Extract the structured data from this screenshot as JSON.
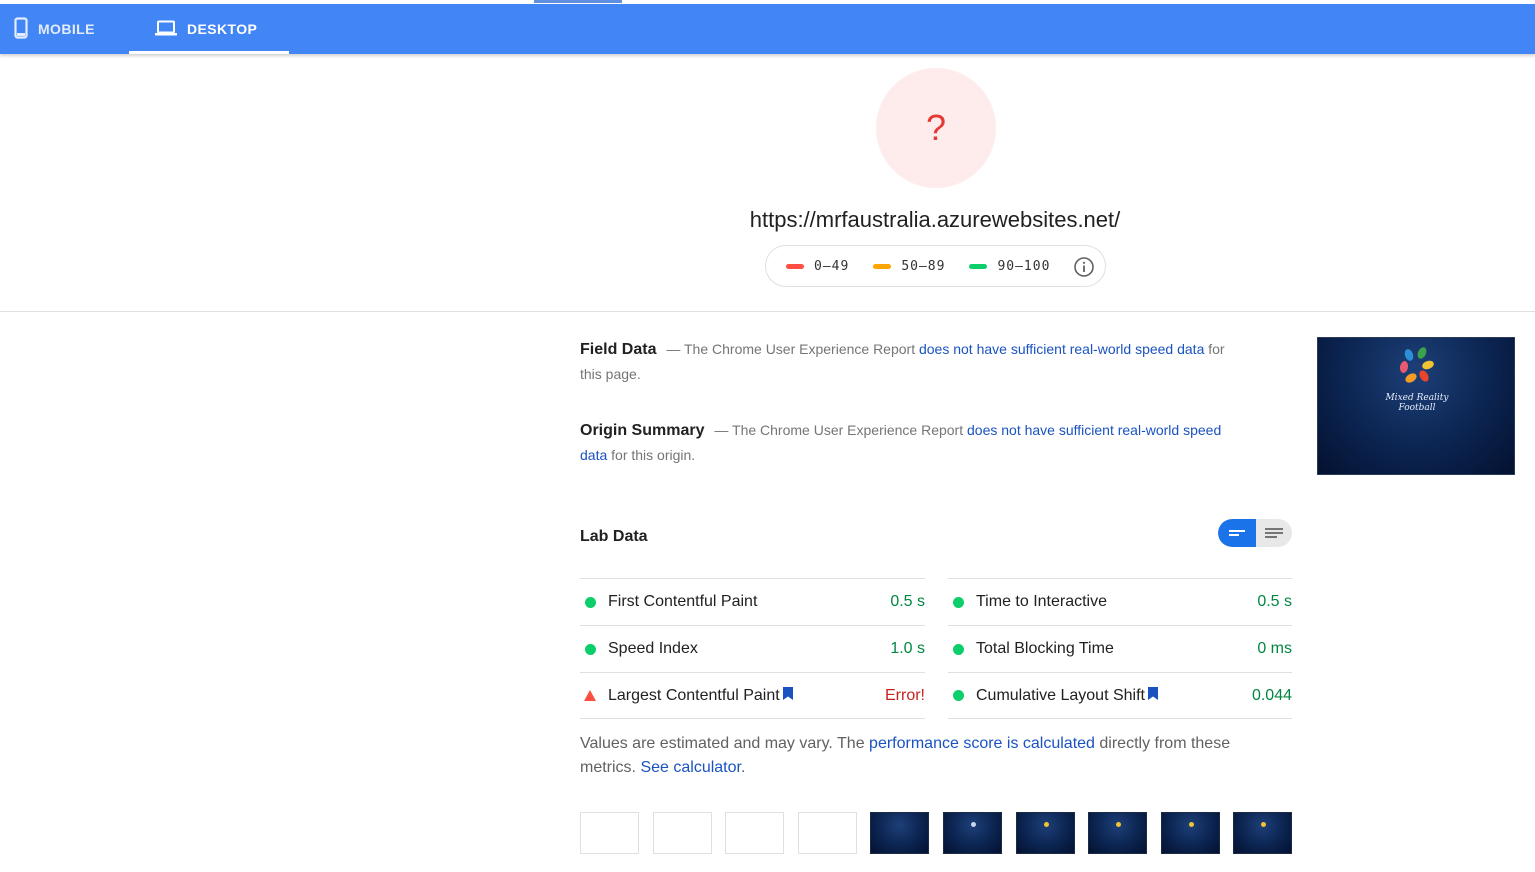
{
  "tabs": [
    {
      "label": "MOBILE",
      "icon": "phone-icon"
    },
    {
      "label": "DESKTOP",
      "icon": "laptop-icon",
      "selected": true
    }
  ],
  "score": {
    "value": "?",
    "color": "#e53935"
  },
  "url": "https://mrfaustralia.azurewebsites.net/",
  "legend": [
    {
      "label": "0–49",
      "color": "#ff4e42"
    },
    {
      "label": "50–89",
      "color": "#ffa400"
    },
    {
      "label": "90–100",
      "color": "#0cce6b"
    }
  ],
  "field_data": {
    "title": "Field Data",
    "prefix": "— The Chrome User Experience Report",
    "link": "does not have sufficient real-world speed data",
    "suffix": "for this page."
  },
  "origin_summary": {
    "title": "Origin Summary",
    "prefix": "— The Chrome User Experience Report",
    "link": "does not have sufficient real-world speed data",
    "suffix": "for this origin."
  },
  "screenshot": {
    "text_line1": "Mixed Reality",
    "text_line2": "Football"
  },
  "lab_data": {
    "title": "Lab Data",
    "metrics_left": [
      {
        "name": "First Contentful Paint",
        "value": "0.5 s",
        "status": "pass"
      },
      {
        "name": "Speed Index",
        "value": "1.0 s",
        "status": "pass"
      },
      {
        "name": "Largest Contentful Paint",
        "value": "Error!",
        "status": "fail",
        "bookmark": true
      }
    ],
    "metrics_right": [
      {
        "name": "Time to Interactive",
        "value": "0.5 s",
        "status": "pass"
      },
      {
        "name": "Total Blocking Time",
        "value": "0 ms",
        "status": "pass"
      },
      {
        "name": "Cumulative Layout Shift",
        "value": "0.044",
        "status": "pass",
        "bookmark": true
      }
    ]
  },
  "footnote": {
    "part1": "Values are estimated and may vary. The",
    "link1": "performance score is calculated",
    "part2": "directly from these metrics.",
    "link2": "See calculator",
    "part3": "."
  },
  "filmstrip": {
    "white_frames": 4,
    "dark_frames": 6
  }
}
